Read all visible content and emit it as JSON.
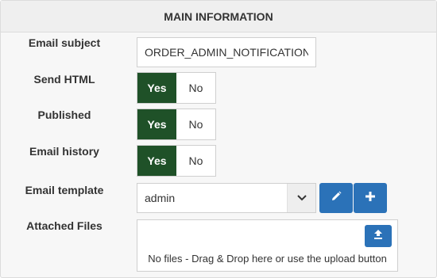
{
  "panel": {
    "title": "MAIN INFORMATION"
  },
  "email_subject": {
    "label": "Email subject",
    "value": "ORDER_ADMIN_NOTIFICATION_S"
  },
  "send_html": {
    "label": "Send HTML",
    "yes": "Yes",
    "no": "No",
    "selected": "Yes"
  },
  "published": {
    "label": "Published",
    "yes": "Yes",
    "no": "No",
    "selected": "Yes"
  },
  "email_history": {
    "label": "Email history",
    "yes": "Yes",
    "no": "No",
    "selected": "Yes"
  },
  "email_template": {
    "label": "Email template",
    "selected_value": "admin",
    "caret_icon": "chevron-down-icon",
    "edit_icon": "pencil-icon",
    "add_icon": "plus-icon"
  },
  "attached_files": {
    "label": "Attached Files",
    "empty_text": "No files - Drag & Drop here or use the upload button",
    "upload_icon": "upload-icon"
  },
  "colors": {
    "toggle_active": "#1f5128",
    "button_primary": "#2b72b8",
    "panel_bg": "#f7f7f7",
    "header_bg": "#efefef"
  }
}
